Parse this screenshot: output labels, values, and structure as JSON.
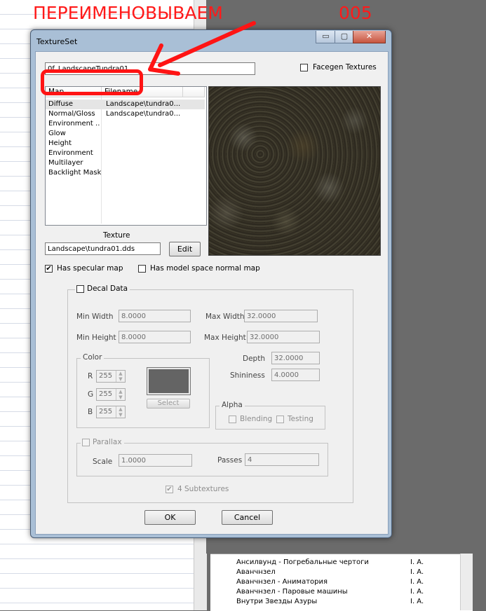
{
  "annotation": {
    "title": "ПЕРЕИМЕНОВЫВАЕМ",
    "number": "005"
  },
  "background_list": {
    "rows": [
      {
        "name": "Ансилвунд - Погребальные чертоги",
        "col2": "I. A."
      },
      {
        "name": "Аванчнзел",
        "col2": "I. A."
      },
      {
        "name": "Аванчнзел - Аниматория",
        "col2": "I. A."
      },
      {
        "name": "Аванчнзел - Паровые машины",
        "col2": "I. A."
      },
      {
        "name": "Внутри Звезды Азуры",
        "col2": "I. A."
      }
    ]
  },
  "dialog": {
    "title": "TextureSet",
    "caption_buttons": {
      "minimize": "▭",
      "maximize": "▢",
      "close": "✕"
    },
    "editor_id": "0f_LandscapeTundra01",
    "facegen_label": "Facegen Textures",
    "map_list": {
      "headers": [
        "Map",
        "Filename"
      ],
      "rows": [
        {
          "map": "Diffuse",
          "file": "Landscape\\tundra0..."
        },
        {
          "map": "Normal/Gloss",
          "file": "Landscape\\tundra0..."
        },
        {
          "map": "Environment ...",
          "file": ""
        },
        {
          "map": "Glow",
          "file": ""
        },
        {
          "map": "Height",
          "file": ""
        },
        {
          "map": "Environment",
          "file": ""
        },
        {
          "map": "Multilayer",
          "file": ""
        },
        {
          "map": "Backlight Mask",
          "file": ""
        }
      ]
    },
    "texture_label": "Texture",
    "texture_path": "Landscape\\tundra01.dds",
    "edit_label": "Edit",
    "has_specular_label": "Has specular map",
    "has_specular_checked": true,
    "has_model_space_label": "Has model space normal map",
    "decal": {
      "label": "Decal Data",
      "min_width_label": "Min Width",
      "min_width": "8.0000",
      "max_width_label": "Max Width",
      "max_width": "32.0000",
      "min_height_label": "Min Height",
      "min_height": "8.0000",
      "max_height_label": "Max Height",
      "max_height": "32.0000",
      "depth_label": "Depth",
      "depth": "32.0000",
      "shininess_label": "Shininess",
      "shininess": "4.0000",
      "color_label": "Color",
      "r_label": "R",
      "r": "255",
      "g_label": "G",
      "g": "255",
      "b_label": "B",
      "b": "255",
      "swatch_color": "#646464",
      "select_label": "Select",
      "alpha_label": "Alpha",
      "blending_label": "Blending",
      "testing_label": "Testing",
      "parallax_label": "Parallax",
      "scale_label": "Scale",
      "scale": "1.0000",
      "passes_label": "Passes",
      "passes": "4",
      "subtextures_label": "4 Subtextures",
      "subtextures_checked": true
    },
    "ok_label": "OK",
    "cancel_label": "Cancel"
  }
}
